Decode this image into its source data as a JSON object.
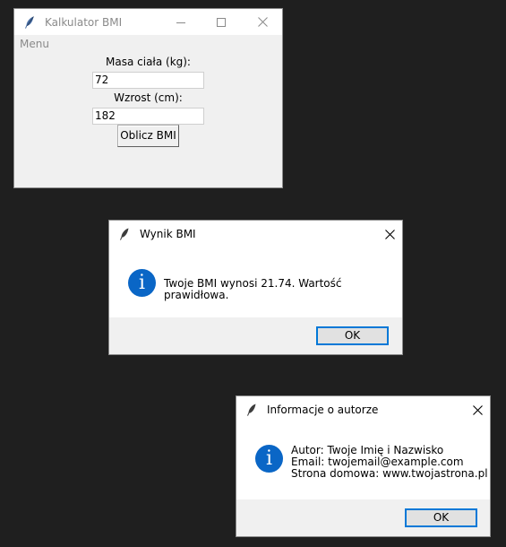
{
  "main_window": {
    "title": "Kalkulator BMI",
    "menu": [
      "Menu"
    ],
    "mass_label": "Masa ciała (kg):",
    "mass_value": "72",
    "height_label": "Wzrost (cm):",
    "height_value": "182",
    "calc_button": "Oblicz BMI"
  },
  "result_dialog": {
    "title": "Wynik BMI",
    "message": "Twoje BMI wynosi 21.74. Wartość prawidłowa.",
    "ok_label": "OK"
  },
  "author_dialog": {
    "title": "Informacje o autorze",
    "lines": [
      "Autor: Twoje Imię i Nazwisko",
      "Email: twojemail@example.com",
      "Strona domowa: www.twojastrona.pl"
    ],
    "ok_label": "OK"
  },
  "icons": {
    "app": "feather-icon",
    "info": "information-icon",
    "close": "close-icon",
    "minimize": "minimize-icon",
    "maximize": "maximize-icon"
  },
  "colors": {
    "desktop": "#1f1f1f",
    "accent": "#0078d7",
    "info_icon": "#0a66c6"
  }
}
